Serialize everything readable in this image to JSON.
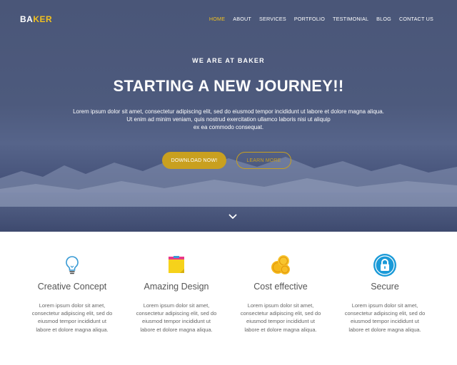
{
  "brand": {
    "part1": "BA",
    "part2": "KER"
  },
  "nav": {
    "items": [
      "HOME",
      "ABOUT",
      "SERVICES",
      "PORTFOLIO",
      "TESTIMONIAL",
      "BLOG",
      "CONTACT US"
    ],
    "active": "HOME"
  },
  "hero": {
    "eyebrow": "WE ARE AT BAKER",
    "title": "STARTING A NEW JOURNEY!!",
    "paragraph_lines": [
      "Lorem ipsum dolor sit amet, consectetur adipiscing elit, sed do eiusmod tempor incididunt ut labore et dolore magna aliqua.",
      "Ut enim ad minim veniam, quis nostrud exercitation ullamco laboris nisi ut aliquip",
      "ex ea commodo consequat."
    ],
    "primary_button": "DOWNLOAD NOW!",
    "secondary_button": "LEARN MORE"
  },
  "features": [
    {
      "title": "Creative Concept",
      "icon": "lightbulb-icon",
      "lines": [
        "Lorem ipsum dolor sit amet,",
        "consectetur adipiscing elit, sed do",
        "eiusmod tempor incididunt ut",
        "labore et dolore magna aliqua."
      ]
    },
    {
      "title": "Amazing Design",
      "icon": "sticky-note-icon",
      "lines": [
        "Lorem ipsum dolor sit amet,",
        "consectetur adipiscing elit, sed do",
        "eiusmod tempor incididunt ut",
        "labore et dolore magna aliqua."
      ]
    },
    {
      "title": "Cost effective",
      "icon": "coins-icon",
      "lines": [
        "Lorem ipsum dolor sit amet,",
        "consectetur adipiscing elit, sed do",
        "eiusmod tempor incididunt ut",
        "labore et dolore magna aliqua."
      ]
    },
    {
      "title": "Secure",
      "icon": "lock-icon",
      "lines": [
        "Lorem ipsum dolor sit amet,",
        "consectetur adipiscing elit, sed do",
        "eiusmod tempor incididunt ut",
        "labore et dolore magna aliqua."
      ]
    }
  ],
  "colors": {
    "accent": "#c9a01f",
    "brand_yellow": "#f0c020",
    "hero_bg": "#4d5a7d",
    "secure_blue": "#1a9ad8"
  }
}
